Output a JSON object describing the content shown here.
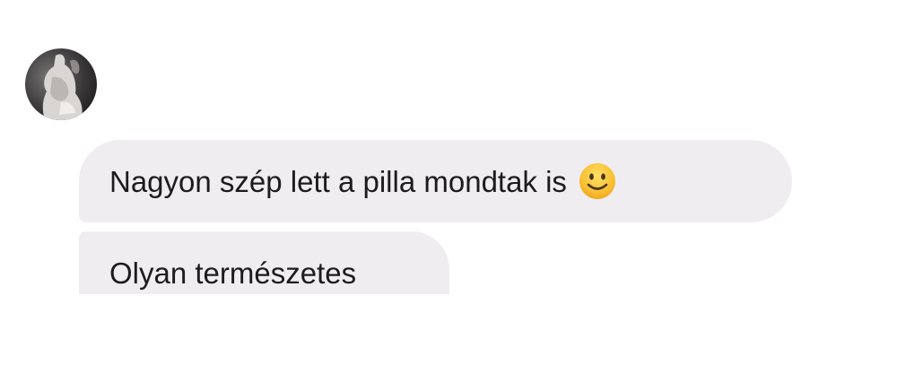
{
  "chat": {
    "messages": [
      {
        "text": "Nagyon szép lett a pilla mondtak is",
        "emoji": "slightly-smiling-face-icon"
      },
      {
        "text": "Olyan természetes"
      }
    ]
  },
  "colors": {
    "bubble_background": "#efedf0",
    "text": "#1c1c1c",
    "emoji_yellow": "#f8b82c"
  }
}
